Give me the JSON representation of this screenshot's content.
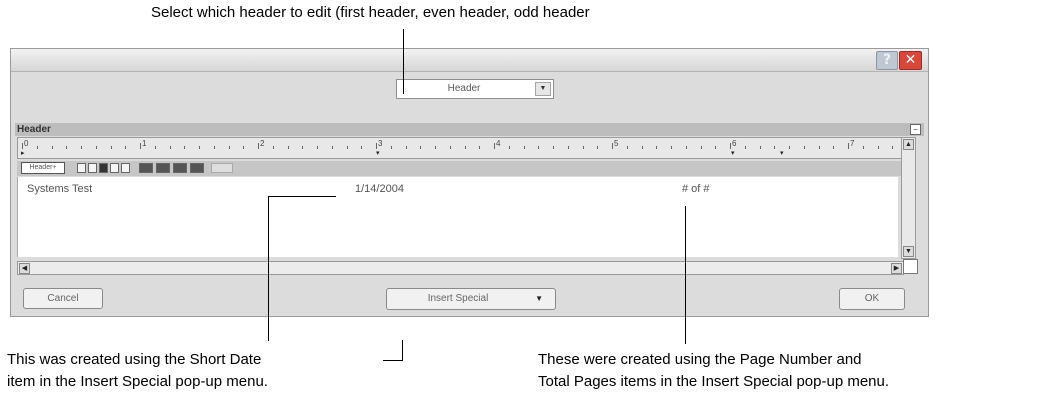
{
  "annotations": {
    "top": "Select which header to edit (first header, even header, odd header",
    "bottom_left_1": "This was created using the Short Date",
    "bottom_left_2": "item in the Insert Special pop-up menu.",
    "bottom_right_1": "These were created using the Page Number and",
    "bottom_right_2": "Total Pages items in the Insert Special pop-up menu."
  },
  "dialog": {
    "title_buttons": {
      "help": "?",
      "close": "✕"
    },
    "header_select": {
      "value": "Header",
      "arrow": "▼"
    },
    "section": {
      "label": "Header",
      "collapse": "−"
    },
    "ruler": {
      "numbers": [
        "0",
        "1",
        "2",
        "3",
        "4",
        "5",
        "6",
        "7"
      ]
    },
    "toolbar": {
      "header_button": "Header+"
    },
    "content": {
      "left": "Systems Test",
      "center": "1/14/2004",
      "right": "# of #"
    },
    "buttons": {
      "cancel": "Cancel",
      "insert_special": "Insert Special",
      "insert_special_arrow": "▼",
      "ok": "OK"
    }
  }
}
